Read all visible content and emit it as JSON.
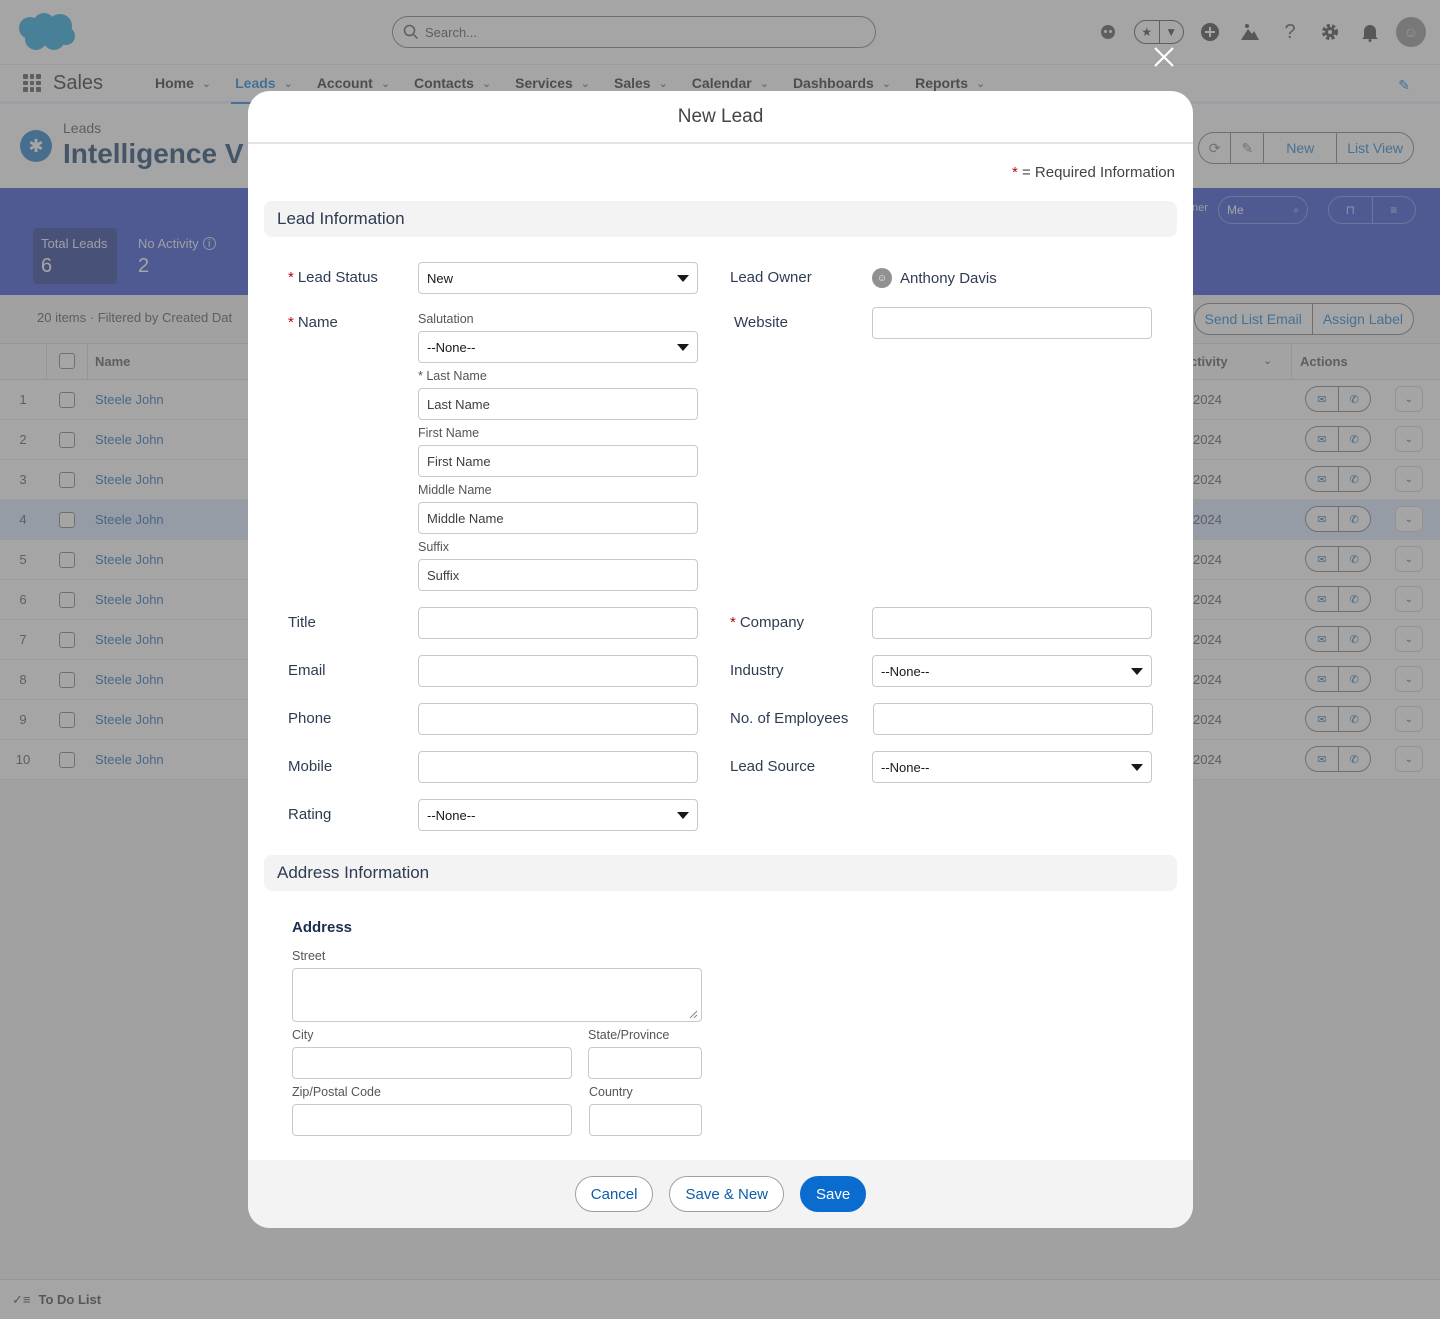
{
  "global_header": {
    "search_placeholder": "Search...",
    "icons": [
      "astro-icon",
      "favorites-star-icon",
      "favorites-dropdown-icon",
      "add-icon",
      "trailhead-icon",
      "help-icon",
      "setup-gear-icon",
      "notifications-bell-icon",
      "user-avatar-icon"
    ]
  },
  "app_nav": {
    "app_name": "Sales",
    "items": [
      {
        "label": "Home",
        "active": false
      },
      {
        "label": "Leads",
        "active": true
      },
      {
        "label": "Account",
        "active": false
      },
      {
        "label": "Contacts",
        "active": false
      },
      {
        "label": "Services",
        "active": false
      },
      {
        "label": "Sales",
        "active": false
      },
      {
        "label": "Calendar",
        "active": false
      },
      {
        "label": "Dashboards",
        "active": false
      },
      {
        "label": "Reports",
        "active": false
      }
    ]
  },
  "page_header": {
    "object_label": "Leads",
    "title": "Intelligence V",
    "actions": [
      "New",
      "List View"
    ]
  },
  "kpis": [
    {
      "label": "Total Leads",
      "value": "6"
    },
    {
      "label": "No Activity",
      "value": "2"
    }
  ],
  "filters": {
    "owner_label": "ner",
    "owner_value": "Me"
  },
  "list": {
    "meta_count": "20 items",
    "meta_filter": "Filtered by Created Dat",
    "actions": [
      "Send List Email",
      "Assign Label"
    ],
    "columns": {
      "name": "Name",
      "activity": "ctivity",
      "actions": "Actions"
    },
    "rows": [
      {
        "num": "1",
        "name": "Steele John",
        "date": "2024"
      },
      {
        "num": "2",
        "name": "Steele John",
        "date": "2024"
      },
      {
        "num": "3",
        "name": "Steele John",
        "date": "2024"
      },
      {
        "num": "4",
        "name": "Steele John",
        "date": "2024"
      },
      {
        "num": "5",
        "name": "Steele John",
        "date": "2024"
      },
      {
        "num": "6",
        "name": "Steele John",
        "date": "2024"
      },
      {
        "num": "7",
        "name": "Steele John",
        "date": "2024"
      },
      {
        "num": "8",
        "name": "Steele John",
        "date": "2024"
      },
      {
        "num": "9",
        "name": "Steele John",
        "date": "2024"
      },
      {
        "num": "10",
        "name": "Steele John",
        "date": "2024"
      }
    ],
    "highlighted_row": 4
  },
  "utility_bar": {
    "label": "To Do List"
  },
  "modal": {
    "title": "New Lead",
    "required_note": "= Required Information",
    "sections": {
      "lead_info": "Lead Information",
      "address_info": "Address Information"
    },
    "fields": {
      "lead_status": {
        "label": "Lead Status",
        "value": "New",
        "required": true
      },
      "name": {
        "label": "Name",
        "required": true
      },
      "salutation": {
        "label": "Salutation",
        "value": "--None--"
      },
      "last_name": {
        "label": "* Last Name",
        "placeholder": "Last Name"
      },
      "first_name": {
        "label": "First Name",
        "placeholder": "First Name"
      },
      "middle_name": {
        "label": "Middle Name",
        "placeholder": "Middle Name"
      },
      "suffix": {
        "label": "Suffix",
        "placeholder": "Suffix"
      },
      "title": {
        "label": "Title",
        "value": ""
      },
      "email": {
        "label": "Email",
        "value": ""
      },
      "phone": {
        "label": "Phone",
        "value": ""
      },
      "mobile": {
        "label": "Mobile",
        "value": ""
      },
      "rating": {
        "label": "Rating",
        "value": "--None--"
      },
      "lead_owner": {
        "label": "Lead Owner",
        "value": "Anthony Davis"
      },
      "website": {
        "label": "Website",
        "value": ""
      },
      "company": {
        "label": "Company",
        "value": "",
        "required": true
      },
      "industry": {
        "label": "Industry",
        "value": "--None--"
      },
      "employees": {
        "label": "No. of Employees",
        "value": ""
      },
      "lead_source": {
        "label": "Lead Source",
        "value": "--None--"
      }
    },
    "address": {
      "title": "Address",
      "street": "Street",
      "city": "City",
      "state": "State/Province",
      "zip": "Zip/Postal Code",
      "country": "Country"
    },
    "buttons": {
      "cancel": "Cancel",
      "save_new": "Save & New",
      "save": "Save"
    }
  },
  "colors": {
    "brand": "#0176d3",
    "kpi_band": "#1f39cc",
    "required": "#ba0517",
    "link": "#0b5cab"
  }
}
